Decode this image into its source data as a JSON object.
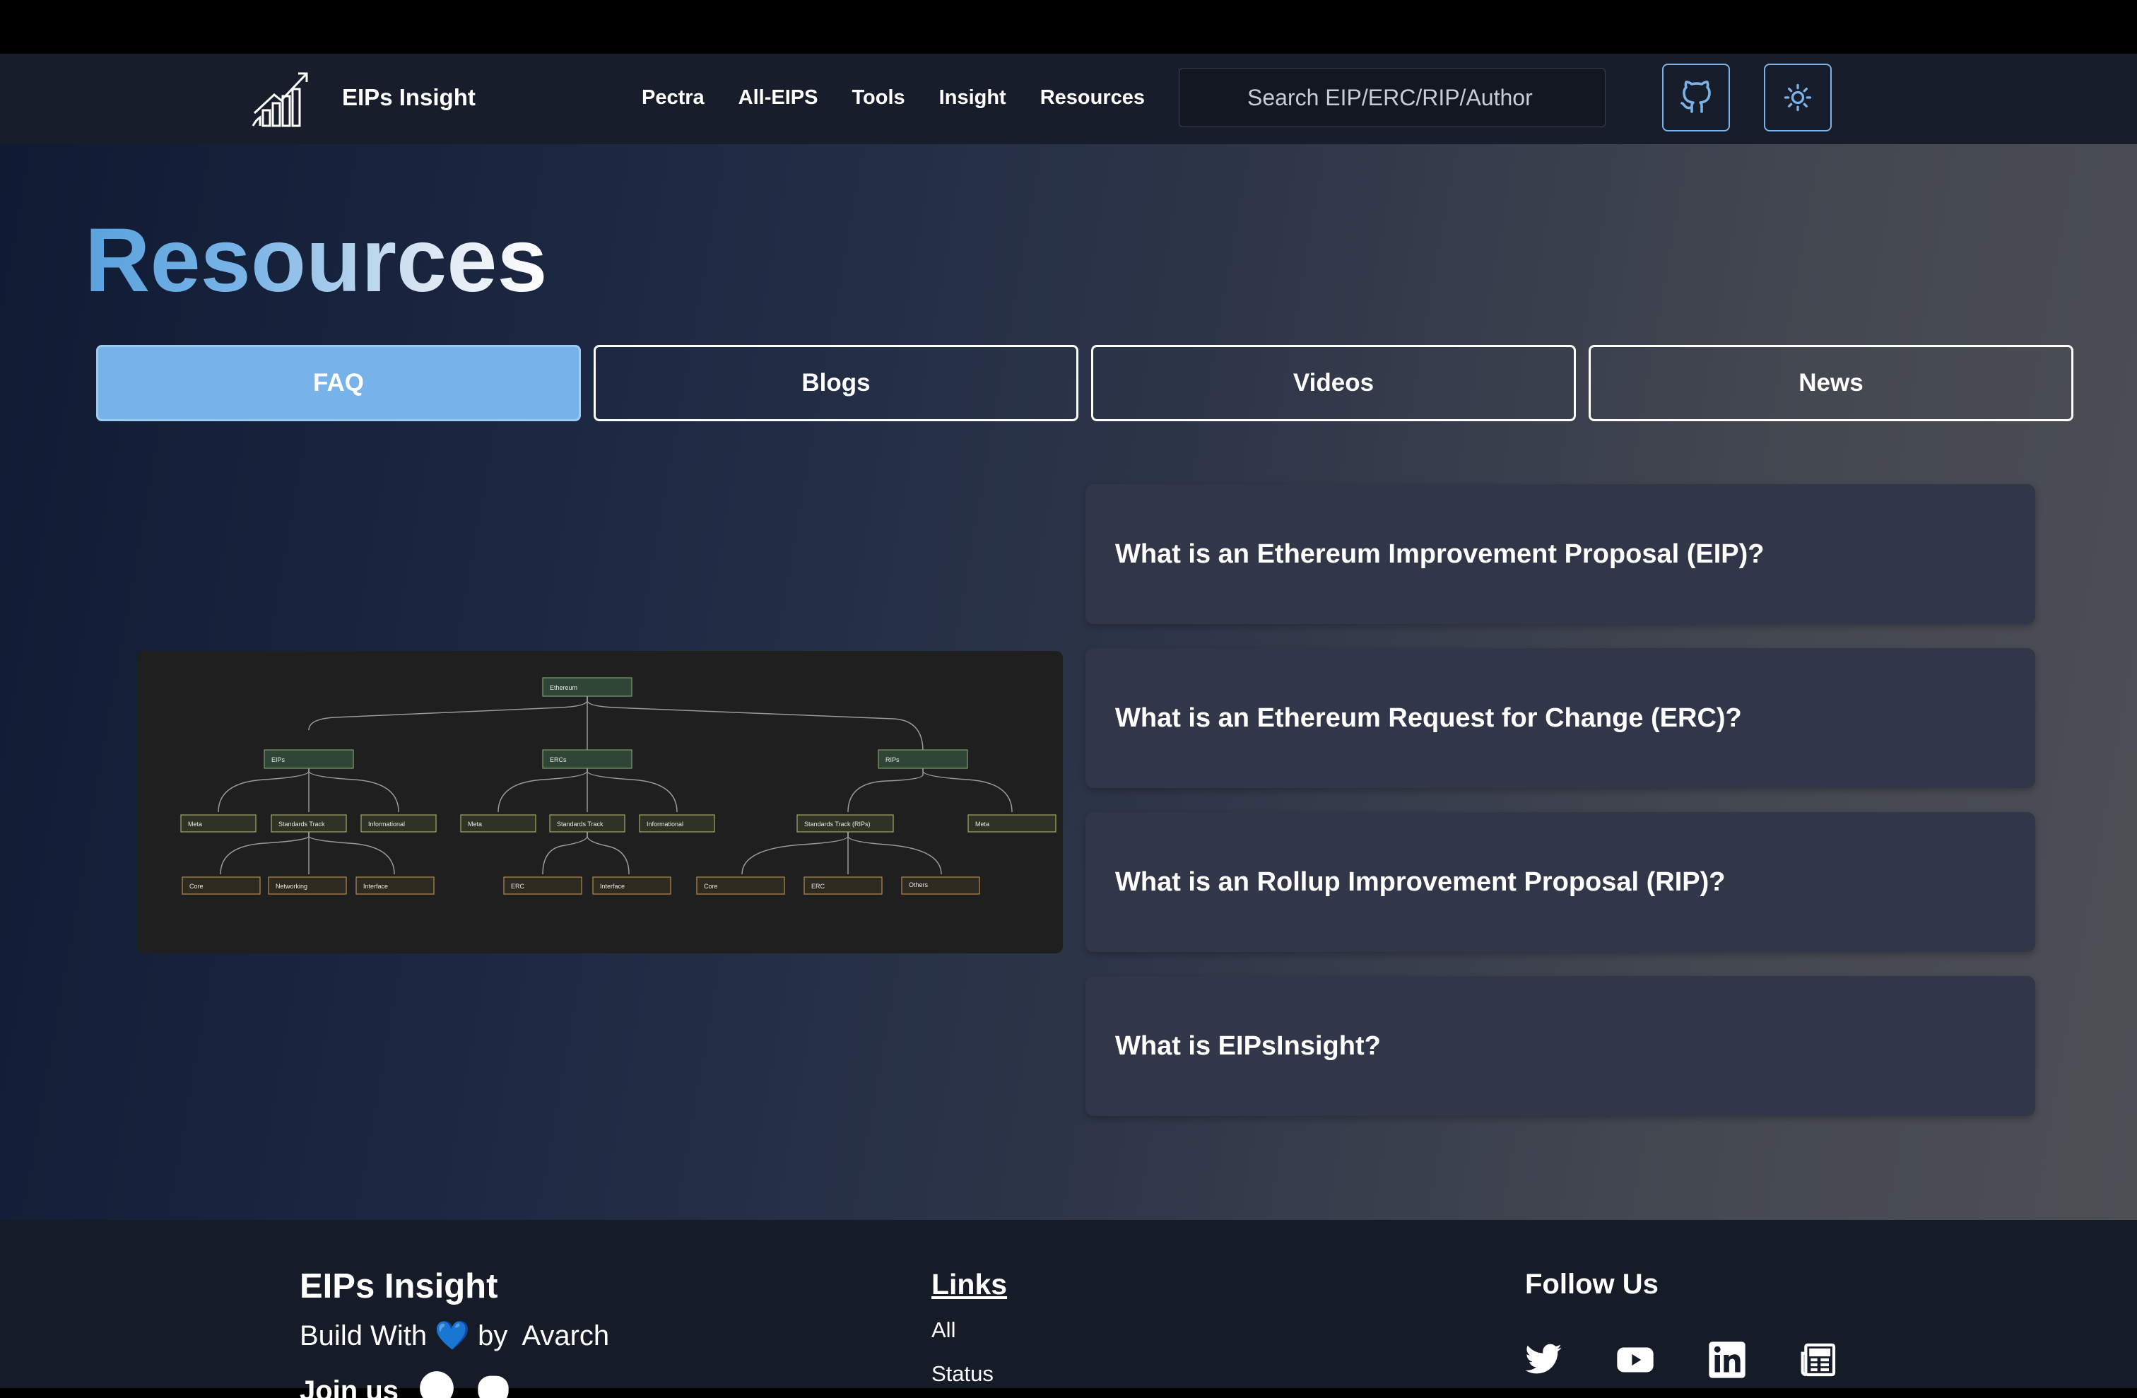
{
  "nav": {
    "brand": "EIPs Insight",
    "menu": [
      "Pectra",
      "All-EIPS",
      "Tools",
      "Insight",
      "Resources"
    ],
    "search_placeholder": "Search EIP/ERC/RIP/Author",
    "icons": [
      "github-icon",
      "sun-icon"
    ]
  },
  "page": {
    "title": "Resources",
    "tabs": [
      {
        "label": "FAQ",
        "active": true
      },
      {
        "label": "Blogs",
        "active": false
      },
      {
        "label": "Videos",
        "active": false
      },
      {
        "label": "News",
        "active": false
      }
    ]
  },
  "diagram": {
    "root": "Ethereum",
    "level1": [
      "EIPs",
      "ERCs",
      "RIPs"
    ],
    "level2": [
      "Meta",
      "Standards Track",
      "Informational",
      "Meta",
      "Standards Track",
      "Informational",
      "Standards Track (RIPs)",
      "Meta"
    ],
    "level3": [
      "Core",
      "Networking",
      "Interface",
      "ERC",
      "Interface",
      "Core",
      "ERC",
      "Others"
    ]
  },
  "faq": [
    "What is an Ethereum Improvement Proposal (EIP)?",
    "What is an Ethereum Request for Change (ERC)?",
    "What is an Rollup Improvement Proposal (RIP)?",
    "What is EIPsInsight?"
  ],
  "footer": {
    "brand": "EIPs Insight",
    "build_prefix": "Build With",
    "heart": "💙",
    "build_suffix": "by  Avarch",
    "join": "Join us",
    "links_heading": "Links",
    "links": [
      "All",
      "Status"
    ],
    "follow_heading": "Follow Us",
    "social_icons": [
      "twitter-icon",
      "youtube-icon",
      "linkedin-icon",
      "newspaper-icon"
    ]
  },
  "colors": {
    "accent": "#77b3e9",
    "nav_bg": "#181d2b",
    "faq_card": "#313749",
    "footer_bg": "#161b28"
  }
}
